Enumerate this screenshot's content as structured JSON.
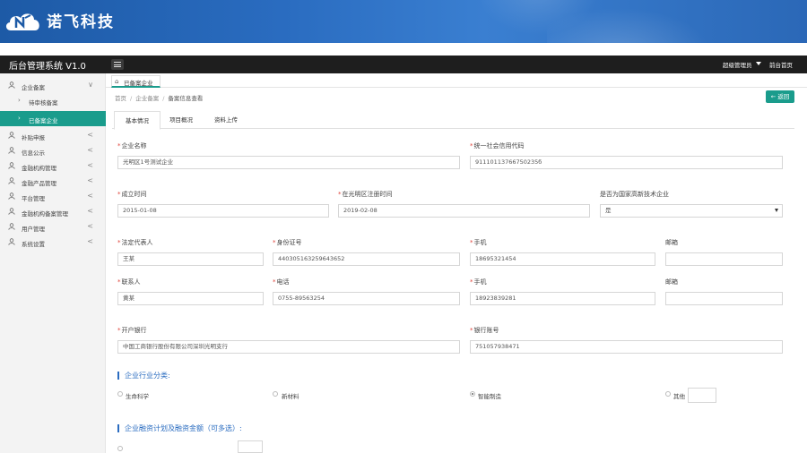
{
  "brand": {
    "name": "诺飞科技"
  },
  "topbar": {
    "system_title": "后台管理系统 V1.0",
    "user": "超级管理员",
    "frontpage": "前台首页"
  },
  "sidebar": {
    "items": [
      {
        "label": "企业备案",
        "chevron": "∨"
      },
      {
        "label": "补贴申报",
        "chevron": "<"
      },
      {
        "label": "信息公示",
        "chevron": "<"
      },
      {
        "label": "金融机构管理",
        "chevron": "<"
      },
      {
        "label": "金融产品管理",
        "chevron": "<"
      },
      {
        "label": "平台管理",
        "chevron": "<"
      },
      {
        "label": "金融机构备案管理",
        "chevron": "<"
      },
      {
        "label": "用户管理",
        "chevron": "<"
      },
      {
        "label": "系统设置",
        "chevron": "<"
      }
    ],
    "subitems": [
      {
        "label": "待审核备案"
      },
      {
        "label": "已备案企业"
      }
    ]
  },
  "tabbar": {
    "home_tab": "已备案企业"
  },
  "breadcrumb": {
    "items": [
      "首页",
      "企业备案",
      "备案信息查看"
    ],
    "sep": "/"
  },
  "back_button": {
    "label": "← 返回"
  },
  "content_tabs": [
    "基本情况",
    "项目概况",
    "资料上传"
  ],
  "form": {
    "company_name": {
      "label": "企业名称",
      "value": "光明区1号测试企业"
    },
    "credit_code": {
      "label": "统一社会信用代码",
      "value": "91110113766750235б"
    },
    "established": {
      "label": "成立时间",
      "value": "2015-01-08"
    },
    "registered": {
      "label": "在光明区注册时间",
      "value": "2019-02-08"
    },
    "hightech": {
      "label": "是否为国家高新技术企业",
      "value": "是"
    },
    "legal_rep": {
      "label": "法定代表人",
      "value": "王某"
    },
    "id_number": {
      "label": "身份证号",
      "value": "440305163259643652"
    },
    "mobile1": {
      "label": "手机",
      "value": "18695321454"
    },
    "email1": {
      "label": "邮箱",
      "value": ""
    },
    "contact": {
      "label": "联系人",
      "value": "黄某"
    },
    "phone": {
      "label": "电话",
      "value": "0755-89563254"
    },
    "mobile2": {
      "label": "手机",
      "value": "18923839281"
    },
    "email2": {
      "label": "邮箱",
      "value": ""
    },
    "bank": {
      "label": "开户银行",
      "value": "中国工商银行股份有限公司深圳光明支行"
    },
    "account": {
      "label": "银行账号",
      "value": "751057938471"
    }
  },
  "industry": {
    "title": "企业行业分类:",
    "options": [
      {
        "label": "生命科学",
        "checked": false
      },
      {
        "label": "新材料",
        "checked": false
      },
      {
        "label": "智能制造",
        "checked": true
      },
      {
        "label": "其他",
        "checked": false
      }
    ]
  },
  "financing": {
    "title": "企业融资计划及融资金额（可多选）:"
  }
}
